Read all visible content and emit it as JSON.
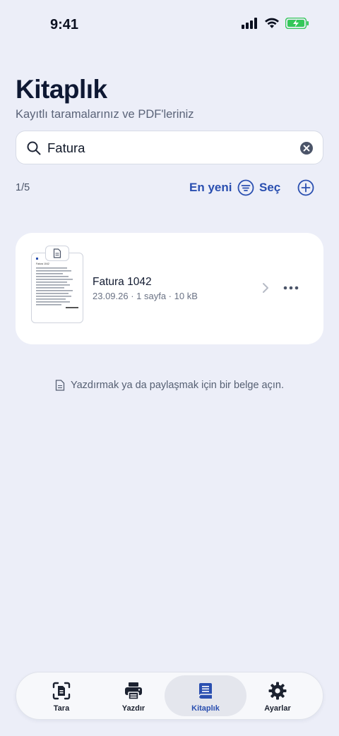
{
  "status_bar": {
    "time": "9:41",
    "icons": [
      "cellular-signal-icon",
      "wifi-icon",
      "battery-charging-icon"
    ]
  },
  "header": {
    "title": "Kitaplık",
    "subtitle": "Kayıtlı taramalarınız ve PDF'leriniz"
  },
  "search": {
    "value": "Fatura",
    "icon": "search-icon",
    "clear_icon": "clear-icon"
  },
  "toolbar": {
    "result_count": "1/5",
    "sort_label": "En yeni",
    "select_label": "Seç"
  },
  "documents": [
    {
      "title": "Fatura 1042",
      "meta": "23.09.26 · 1 sayfa · 10 kB",
      "thumb_heading": "Fatura 1042"
    }
  ],
  "hint": {
    "text": "Yazdırmak ya da paylaşmak için bir belge açın."
  },
  "tab_bar": {
    "tabs": [
      {
        "label": "Tara",
        "icon": "scan-icon",
        "active": false
      },
      {
        "label": "Yazdır",
        "icon": "printer-icon",
        "active": false
      },
      {
        "label": "Kitaplık",
        "icon": "library-icon",
        "active": true
      },
      {
        "label": "Ayarlar",
        "icon": "gear-icon",
        "active": false
      }
    ]
  },
  "colors": {
    "background": "#eceef8",
    "accent": "#2a4fb0",
    "battery": "#34c759"
  }
}
